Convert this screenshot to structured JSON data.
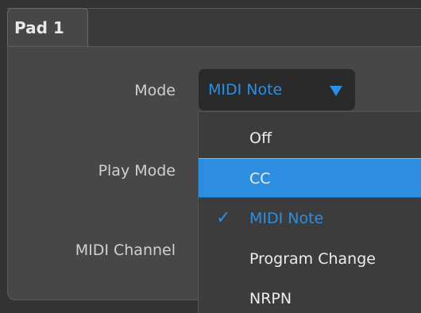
{
  "tab": {
    "label": "Pad 1"
  },
  "fields": {
    "mode_label": "Mode",
    "play_mode_label": "Play Mode",
    "midi_channel_label": "MIDI Channel"
  },
  "mode_select": {
    "value": "MIDI Note",
    "arrow_icon": "triangle-down-icon",
    "accent_color": "#2b8fe6"
  },
  "dropdown": {
    "items": [
      {
        "label": "Off",
        "highlighted": false,
        "selected": false
      },
      {
        "label": "CC",
        "highlighted": true,
        "selected": false
      },
      {
        "label": "MIDI Note",
        "highlighted": false,
        "selected": true
      },
      {
        "label": "Program Change",
        "highlighted": false,
        "selected": false
      },
      {
        "label": "NRPN",
        "highlighted": false,
        "selected": false
      }
    ],
    "check_glyph": "✓",
    "highlight_color": "#2d8de0"
  }
}
